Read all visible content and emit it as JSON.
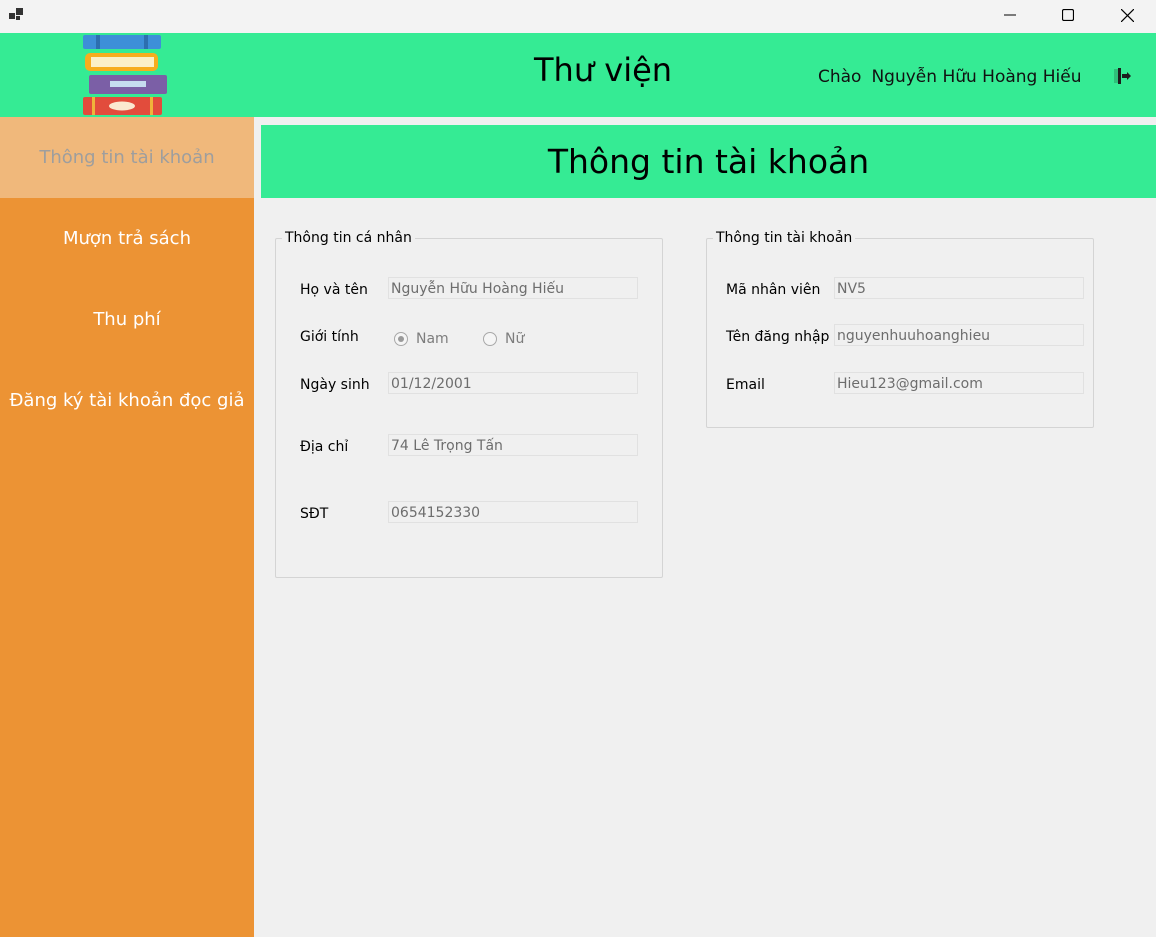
{
  "window": {
    "minimize_icon": "minimize-icon",
    "maximize_icon": "maximize-icon",
    "close_icon": "close-icon"
  },
  "header": {
    "title": "Thư viện",
    "greeting_prefix": "Chào",
    "user_name": "Nguyễn Hữu Hoàng Hiếu",
    "logo_icon": "books-stack-icon",
    "logout_icon": "logout-icon",
    "bg_color": "#35eb94"
  },
  "sidebar": {
    "bg_color": "#ec9334",
    "active_color": "#f0b87b",
    "items": [
      {
        "label": "Thông tin tài khoản",
        "active": true
      },
      {
        "label": "Mượn trả sách",
        "active": false
      },
      {
        "label": "Thu phí",
        "active": false
      },
      {
        "label": "Đăng ký tài khoản đọc giả",
        "active": false
      }
    ]
  },
  "main": {
    "title": "Thông tin tài khoản",
    "personal": {
      "legend": "Thông tin cá nhân",
      "name_label": "Họ và tên",
      "name_value": "Nguyễn Hữu Hoàng Hiếu",
      "gender_label": "Giới tính",
      "gender_options": [
        "Nam",
        "Nữ"
      ],
      "gender_selected": "Nam",
      "dob_label": "Ngày sinh",
      "dob_value": "01/12/2001",
      "address_label": "Địa chỉ",
      "address_value": "74 Lê Trọng Tấn",
      "phone_label": "SĐT",
      "phone_value": "0654152330"
    },
    "account": {
      "legend": "Thông tin tài khoản",
      "staff_id_label": "Mã nhân viên",
      "staff_id_value": "NV5",
      "username_label": "Tên đăng nhập",
      "username_value": "nguyenhuuhoanghieu",
      "email_label": "Email",
      "email_value": "Hieu123@gmail.com"
    }
  }
}
